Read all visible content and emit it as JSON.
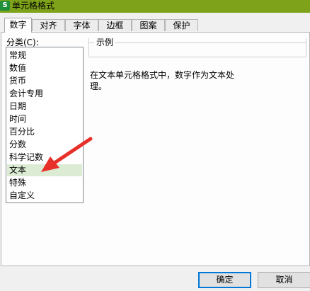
{
  "window": {
    "title": "单元格格式",
    "app_icon": "wps-spreadsheet-icon",
    "title_bar_color": "#7ea21a"
  },
  "tabs": [
    {
      "label": "数字",
      "active": true
    },
    {
      "label": "对齐"
    },
    {
      "label": "字体"
    },
    {
      "label": "边框"
    },
    {
      "label": "图案"
    },
    {
      "label": "保护"
    }
  ],
  "category": {
    "label": "分类(C):",
    "items": [
      "常规",
      "数值",
      "货币",
      "会计专用",
      "日期",
      "时间",
      "百分比",
      "分数",
      "科学记数",
      "文本",
      "特殊",
      "自定义"
    ],
    "selected": "文本",
    "selected_color": "#dbebd4"
  },
  "sample": {
    "title": "示例"
  },
  "description": "在文本单元格格式中，数字作为文本处\n理。",
  "annotation": {
    "type": "red arrow pointing to selected category",
    "color": "#e8302a"
  },
  "buttons": {
    "ok": "确定",
    "cancel": "取消"
  }
}
